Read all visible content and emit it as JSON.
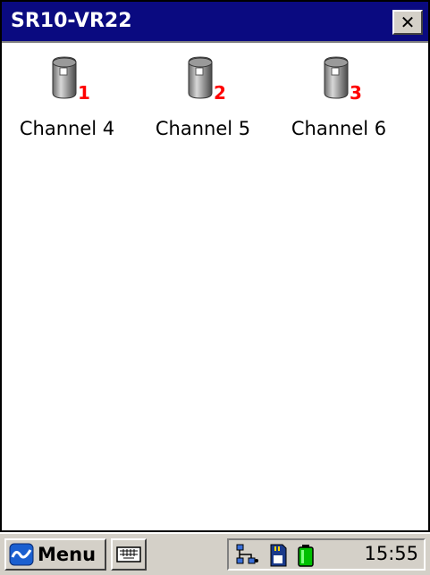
{
  "window": {
    "title": "SR10-VR22",
    "close_glyph": "✕"
  },
  "channels": [
    {
      "number": "1",
      "label": "Channel 4"
    },
    {
      "number": "2",
      "label": "Channel 5"
    },
    {
      "number": "3",
      "label": "Channel 6"
    }
  ],
  "taskbar": {
    "menu_label": "Menu",
    "clock": "15:55"
  },
  "colors": {
    "titlebar": "#0a0a80",
    "badge": "#ff0000",
    "battery": "#00c000"
  },
  "icons": [
    "database-icon",
    "keyboard-icon",
    "network-icon",
    "memory-card-icon",
    "battery-icon",
    "start-logo-icon"
  ]
}
